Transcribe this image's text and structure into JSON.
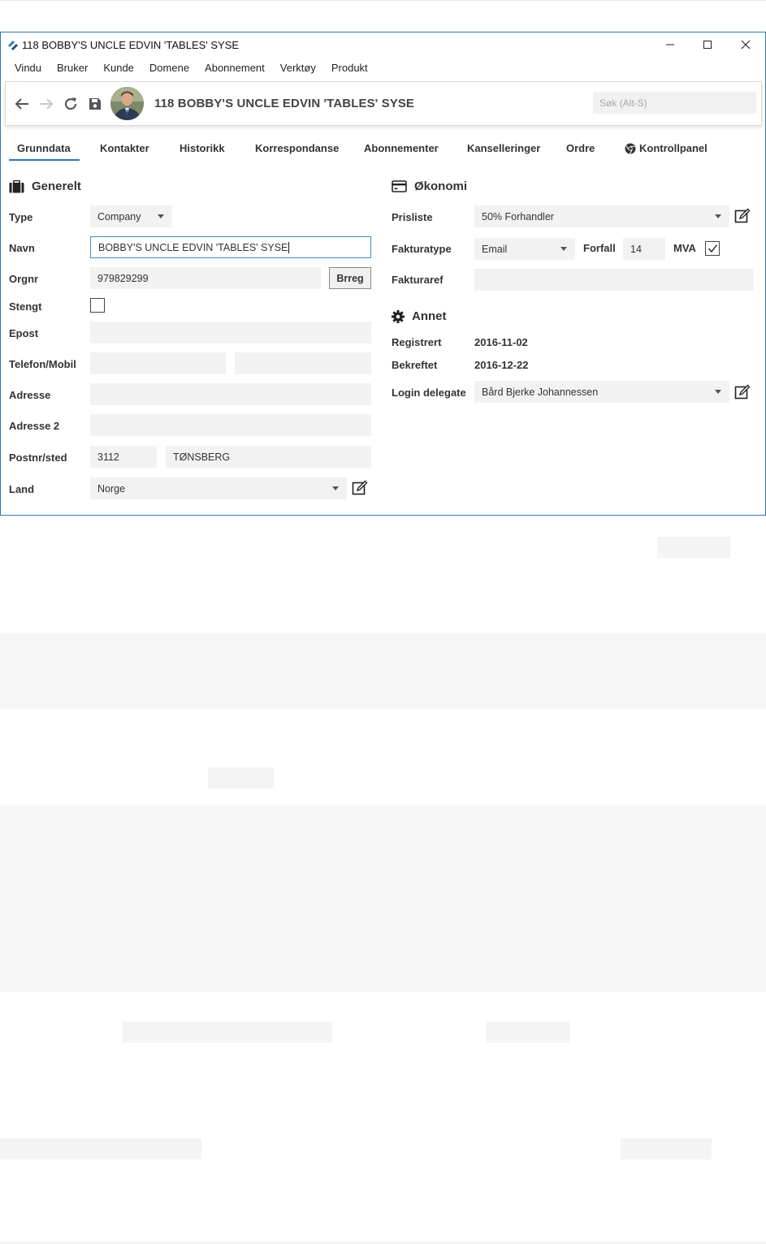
{
  "window": {
    "title": "118 BOBBY'S UNCLE EDVIN 'TABLES' SYSE",
    "minimize": "—",
    "maximize": "☐",
    "close": "✕"
  },
  "menu": [
    "Vindu",
    "Bruker",
    "Kunde",
    "Domene",
    "Abonnement",
    "Verktøy",
    "Produkt"
  ],
  "toolbar": {
    "title": "118 BOBBY'S UNCLE EDVIN 'TABLES' SYSE",
    "search_placeholder": "Søk (Alt-S)",
    "icons": [
      "back-arrow-icon",
      "forward-arrow-icon",
      "refresh-icon",
      "save-icon"
    ]
  },
  "tabs": [
    "Grunndata",
    "Kontakter",
    "Historikk",
    "Korrespondanse",
    "Abonnementer",
    "Kanselleringer",
    "Ordre",
    "Kontrollpanel"
  ],
  "active_tab": "Grunndata",
  "generelt": {
    "title": "Generelt",
    "type_label": "Type",
    "type_value": "Company",
    "navn_label": "Navn",
    "navn_value": "BOBBY'S UNCLE EDVIN 'TABLES' SYSE",
    "orgnr_label": "Orgnr",
    "orgnr_value": "979829299",
    "brreg_button": "Brreg",
    "stengt_label": "Stengt",
    "stengt_checked": false,
    "epost_label": "Epost",
    "epost_value": "",
    "telefon_label": "Telefon/Mobil",
    "telefon_value": "",
    "mobil_value": "",
    "adresse_label": "Adresse",
    "adresse_value": "",
    "adresse2_label": "Adresse 2",
    "adresse2_value": "",
    "postnr_label": "Postnr/sted",
    "postnr_value": "3112",
    "sted_value": "TØNSBERG",
    "land_label": "Land",
    "land_value": "Norge"
  },
  "okonomi": {
    "title": "Økonomi",
    "prisliste_label": "Prisliste",
    "prisliste_value": "50% Forhandler",
    "fakturatype_label": "Fakturatype",
    "fakturatype_value": "Email",
    "forfall_label": "Forfall",
    "forfall_value": "14",
    "mva_label": "MVA",
    "mva_checked": true,
    "fakturaref_label": "Fakturaref",
    "fakturaref_value": ""
  },
  "annet": {
    "title": "Annet",
    "registrert_label": "Registrert",
    "registrert_value": "2016-11-02",
    "bekreftet_label": "Bekreftet",
    "bekreftet_value": "2016-12-22",
    "login_delegate_label": "Login delegate",
    "login_delegate_value": "Bård Bjerke Johannessen"
  },
  "colors": {
    "accent": "#2f7ab8",
    "field_bg": "#f2f2f2",
    "ghost_bg": "#f6f6f6"
  }
}
